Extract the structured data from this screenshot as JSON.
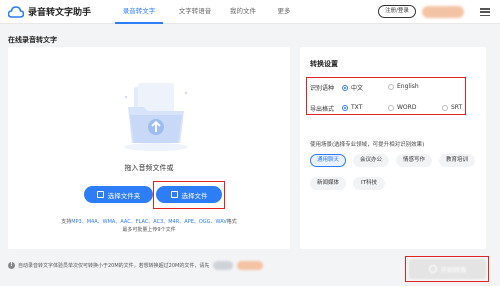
{
  "app": {
    "title": "录音转文字助手"
  },
  "nav": [
    {
      "label": "录音转文字",
      "active": true
    },
    {
      "label": "文字转语音",
      "active": false
    },
    {
      "label": "我的文件",
      "active": false
    },
    {
      "label": "更多",
      "active": false
    }
  ],
  "header": {
    "login_label": "注册/登录",
    "user_label": ""
  },
  "page": {
    "title": "在线录音转文字"
  },
  "upload": {
    "drop_label": "拖入音频文件或",
    "select_folder_label": "选择文件夹",
    "select_file_label": "选择文件",
    "formats_prefix": "支持",
    "formats": "MP3、M4A、WMA、AAC、FLAC、AC3、M4R、APE、OGG、WAV",
    "formats_suffix": "格式",
    "limit_text": "最多可批量上传9个文件"
  },
  "settings": {
    "title": "转换设置",
    "language": {
      "label": "识别语种",
      "options": [
        "中文",
        "English"
      ],
      "selected": "中文"
    },
    "format": {
      "label": "导出格式",
      "options": [
        "TXT",
        "WORD",
        "SRT"
      ],
      "selected": "TXT"
    },
    "scene_desc": "使用场景(选择专业领域，可提升相对识别效果)",
    "scenes": [
      {
        "label": "通用聊天",
        "active": true
      },
      {
        "label": "会议办公",
        "active": false
      },
      {
        "label": "情感写作",
        "active": false
      },
      {
        "label": "教育培训",
        "active": false
      },
      {
        "label": "新闻媒体",
        "active": false
      },
      {
        "label": "IT科技",
        "active": false
      }
    ]
  },
  "footer": {
    "notice": "自动录音转文字体验员单次仅可转换小于20M的文件，若想转换超过20M的文件，请先",
    "start_label": "开始转换"
  },
  "colors": {
    "accent": "#2d7df6",
    "highlight_border": "#e02424"
  }
}
